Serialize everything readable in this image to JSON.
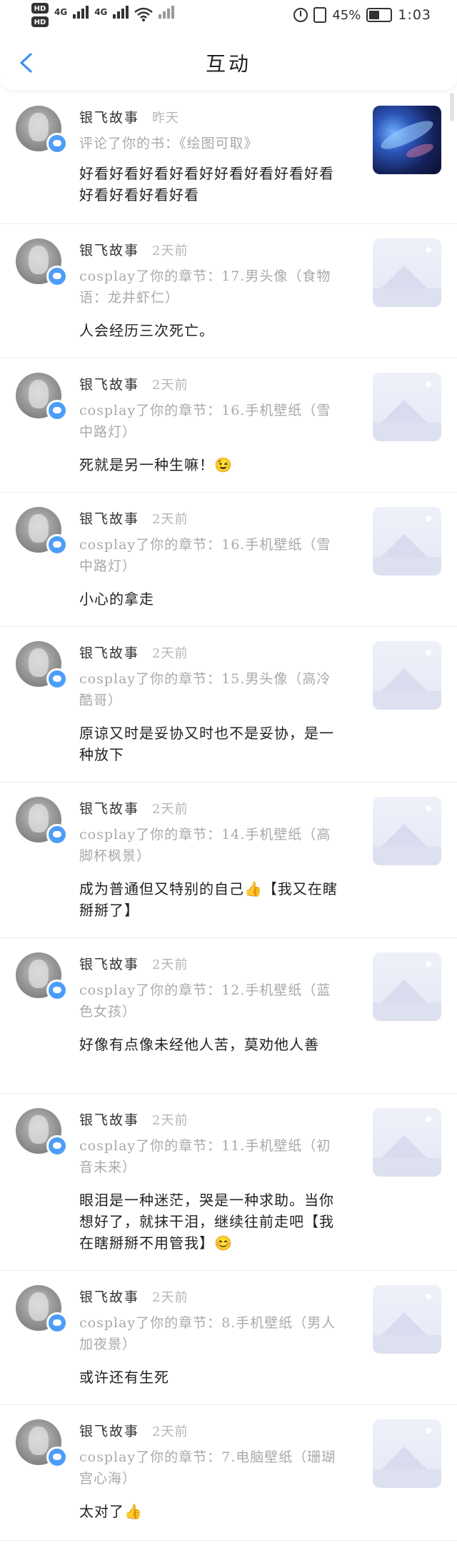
{
  "status_bar": {
    "hd1": "HD",
    "hd2": "HD",
    "net1": "4G",
    "net2": "4G",
    "battery": "45%",
    "time": "1:03"
  },
  "header": {
    "title": "互动"
  },
  "items": [
    {
      "name": "银飞故事",
      "time": "昨天",
      "source": "评论了你的书：《绘图可取》",
      "comment": "好看好看好看好看好好看好看好看好看好看好看好看好看",
      "thumb": "galaxy"
    },
    {
      "name": "银飞故事",
      "time": "2天前",
      "source": "cosplay了你的章节：17.男头像（食物语：龙井虾仁）",
      "comment": "人会经历三次死亡。",
      "thumb": "placeholder"
    },
    {
      "name": "银飞故事",
      "time": "2天前",
      "source": "cosplay了你的章节：16.手机壁纸（雪中路灯）",
      "comment": "死就是另一种生嘛！😉",
      "thumb": "placeholder"
    },
    {
      "name": "银飞故事",
      "time": "2天前",
      "source": "cosplay了你的章节：16.手机壁纸（雪中路灯）",
      "comment": "小心的拿走",
      "thumb": "placeholder"
    },
    {
      "name": "银飞故事",
      "time": "2天前",
      "source": "cosplay了你的章节：15.男头像（高冷酷哥）",
      "comment": "原谅又时是妥协又时也不是妥协，是一种放下",
      "thumb": "placeholder"
    },
    {
      "name": "银飞故事",
      "time": "2天前",
      "source": "cosplay了你的章节：14.手机壁纸（高脚杯枫景）",
      "comment": "成为普通但又特别的自己👍【我又在瞎掰掰了】",
      "thumb": "placeholder"
    },
    {
      "name": "银飞故事",
      "time": "2天前",
      "source": "cosplay了你的章节：12.手机壁纸（蓝色女孩）",
      "comment": "好像有点像未经他人苦，莫劝他人善",
      "thumb": "placeholder"
    },
    {
      "name": "银飞故事",
      "time": "2天前",
      "source": "cosplay了你的章节：11.手机壁纸（初音未来）",
      "comment": "眼泪是一种迷茫，哭是一种求助。当你想好了，就抹干泪，继续往前走吧【我在瞎掰掰不用管我】😊",
      "thumb": "placeholder"
    },
    {
      "name": "银飞故事",
      "time": "2天前",
      "source": "cosplay了你的章节：8.手机壁纸（男人加夜景）",
      "comment": "或许还有生死",
      "thumb": "placeholder"
    },
    {
      "name": "银飞故事",
      "time": "2天前",
      "source": "cosplay了你的章节：7.电脑壁纸（珊瑚宫心海）",
      "comment": "太对了👍",
      "thumb": "placeholder"
    }
  ]
}
